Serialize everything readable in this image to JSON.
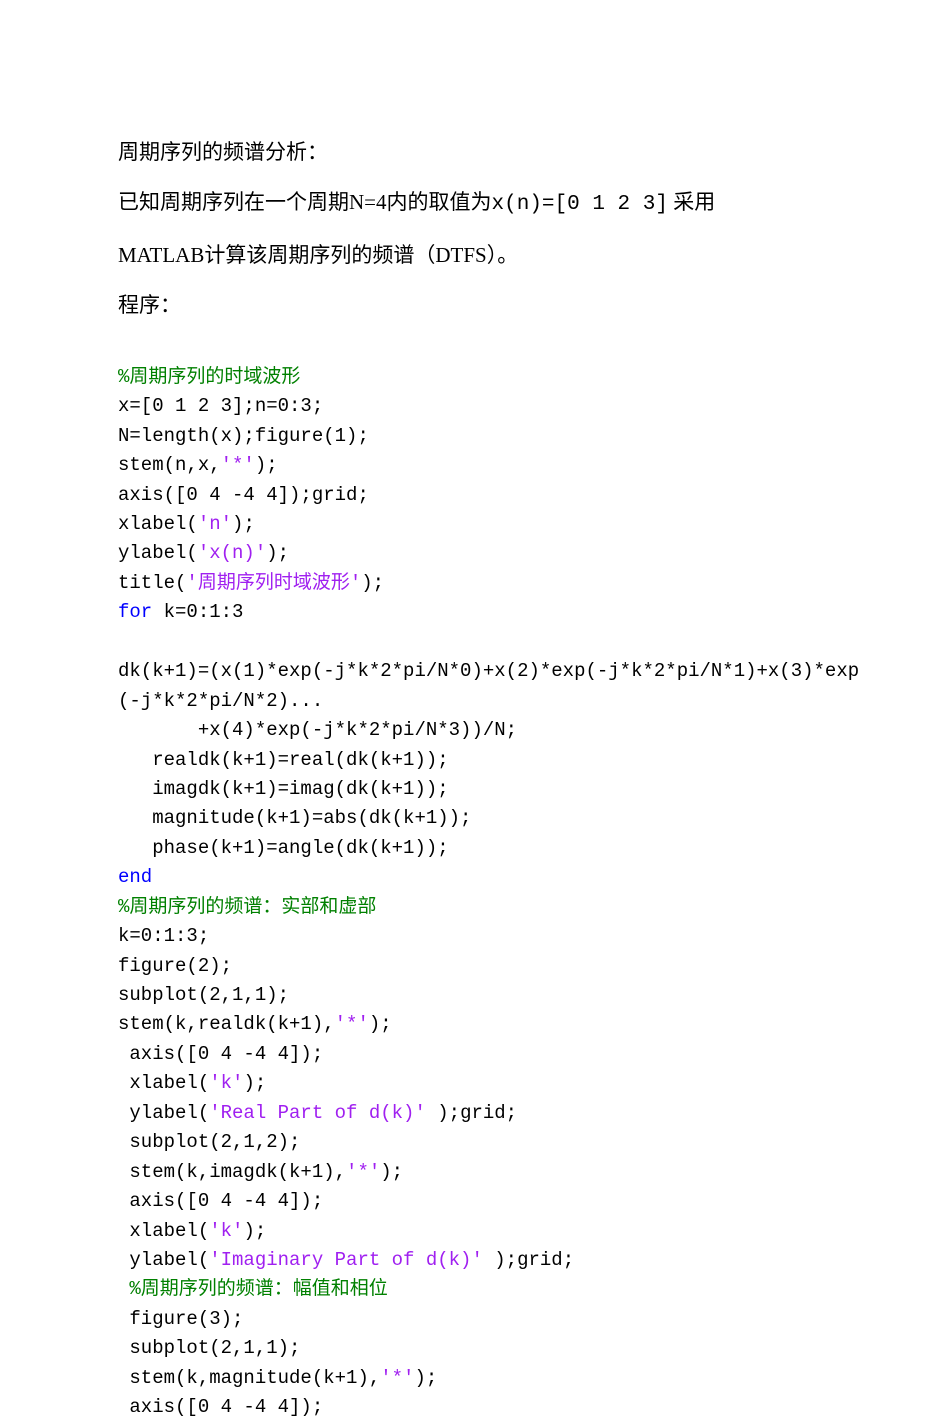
{
  "prose": {
    "p1": "周期序列的频谱分析：",
    "p2_a": "已知周期序列在一个周期N=4内的取值为",
    "p2_b": "x(n)=[0 1 2 3]",
    "p2_c": " 采用",
    "p3": "MATLAB计算该周期序列的频谱（DTFS）。",
    "p4": "程序："
  },
  "code": {
    "c01_comment": "%周期序列的时域波形",
    "c02": "x=[0 1 2 3];n=0:3;",
    "c03": "N=length(x);figure(1);",
    "c04_a": "stem(n,x,",
    "c04_s": "'*'",
    "c04_b": ");",
    "c05": "axis([0 4 -4 4]);grid;",
    "c06_a": "xlabel(",
    "c06_s": "'n'",
    "c06_b": ");",
    "c07_a": "ylabel(",
    "c07_s": "'x(n)'",
    "c07_b": ");",
    "c08_a": "title(",
    "c08_s": "'周期序列时域波形'",
    "c08_b": ");",
    "c09_k": "for",
    "c09_b": " k=0:1:3",
    "c10": "",
    "c11": "dk(k+1)=(x(1)*exp(-j*k*2*pi/N*0)+x(2)*exp(-j*k*2*pi/N*1)+x(3)*exp",
    "c12": "(-j*k*2*pi/N*2)...",
    "c13": "       +x(4)*exp(-j*k*2*pi/N*3))/N;",
    "c14": "   realdk(k+1)=real(dk(k+1));",
    "c15": "   imagdk(k+1)=imag(dk(k+1));",
    "c16": "   magnitude(k+1)=abs(dk(k+1));",
    "c17": "   phase(k+1)=angle(dk(k+1));",
    "c18_k": "end",
    "c19_comment": "%周期序列的频谱：实部和虚部",
    "c20": "k=0:1:3;",
    "c21": "figure(2);",
    "c22": "subplot(2,1,1);",
    "c23_a": "stem(k,realdk(k+1),",
    "c23_s": "'*'",
    "c23_b": ");",
    "c24": " axis([0 4 -4 4]);",
    "c25_a": " xlabel(",
    "c25_s": "'k'",
    "c25_b": ");",
    "c26_a": " ylabel(",
    "c26_s": "'Real Part of d(k)'",
    "c26_b": " );grid;",
    "c27": " subplot(2,1,2);",
    "c28_a": " stem(k,imagdk(k+1),",
    "c28_s": "'*'",
    "c28_b": ");",
    "c29": " axis([0 4 -4 4]);",
    "c30_a": " xlabel(",
    "c30_s": "'k'",
    "c30_b": ");",
    "c31_a": " ylabel(",
    "c31_s": "'Imaginary Part of d(k)'",
    "c31_b": " );grid;",
    "c32_comment": " %周期序列的频谱：幅值和相位",
    "c33": " figure(3);",
    "c34": " subplot(2,1,1);",
    "c35_a": " stem(k,magnitude(k+1),",
    "c35_s": "'*'",
    "c35_b": ");",
    "c36": " axis([0 4 -4 4]);"
  }
}
